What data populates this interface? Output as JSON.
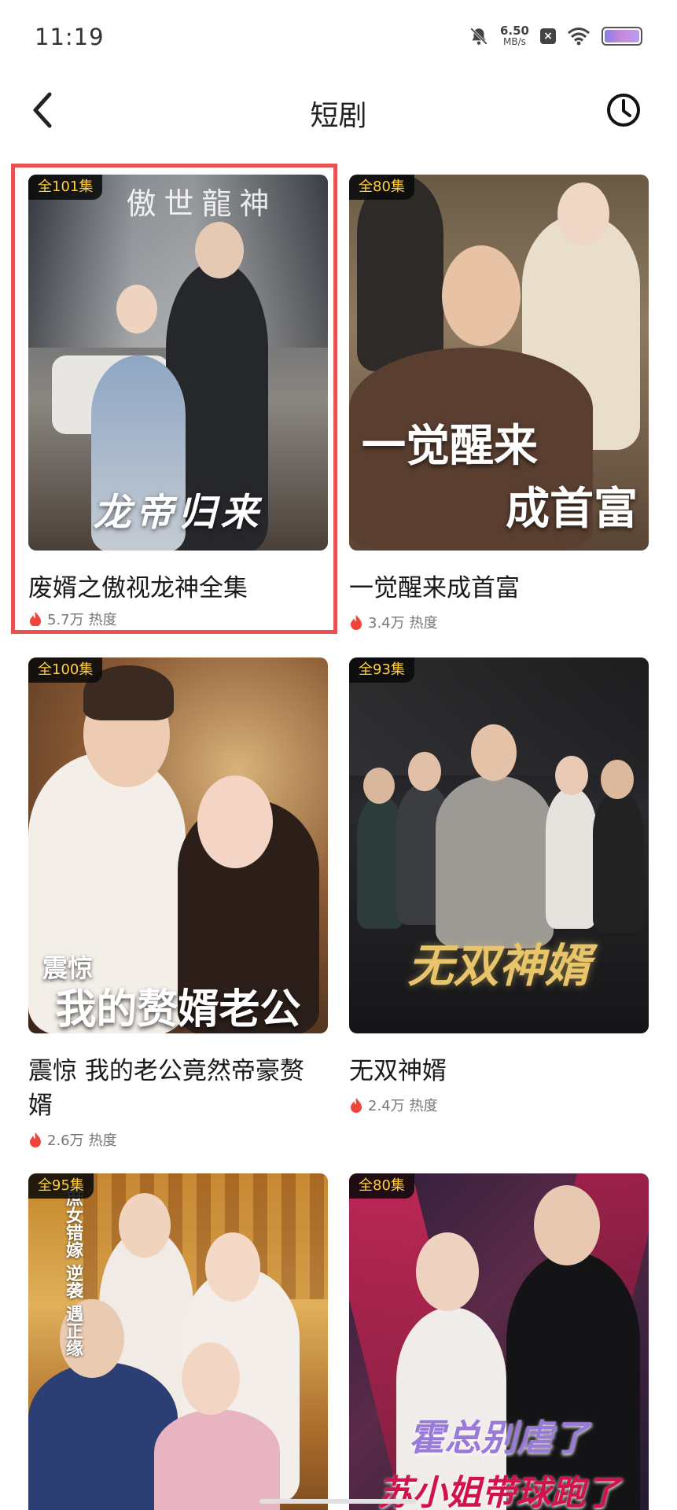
{
  "status_bar": {
    "time": "11:19",
    "net_speed": "6.50",
    "net_unit": "MB/s",
    "icons": [
      "bell-off-icon",
      "x-badge-icon",
      "wifi-icon",
      "battery-icon"
    ]
  },
  "header": {
    "title": "短剧",
    "back_icon": "chevron-left-icon",
    "history_icon": "clock-icon"
  },
  "cards": [
    {
      "badge": "全101集",
      "poster_top_text": "傲世龍神",
      "poster_title": "龙帝归来",
      "title": "废婿之傲视龙神全集",
      "heat": "5.7万",
      "heat_label": "热度",
      "highlighted": true
    },
    {
      "badge": "全80集",
      "poster_title_line1": "一觉醒来",
      "poster_title_line2": "成首富",
      "title": "一觉醒来成首富",
      "heat": "3.4万",
      "heat_label": "热度"
    },
    {
      "badge": "全100集",
      "poster_sub": "震惊",
      "poster_title": "我的赘婿老公",
      "title": "震惊 我的老公竟然帝豪赘婿",
      "heat": "2.6万",
      "heat_label": "热度"
    },
    {
      "badge": "全93集",
      "poster_title": "无双神婿",
      "title": "无双神婿",
      "heat": "2.4万",
      "heat_label": "热度"
    },
    {
      "badge": "全95集",
      "poster_side_text": "庶女错嫁 逆袭 遇正缘",
      "title": "",
      "heat": "",
      "heat_label": ""
    },
    {
      "badge": "全80集",
      "poster_title_line1": "霍总别虐了",
      "poster_title_line2": "苏小姐带球跑了",
      "title": "",
      "heat": "",
      "heat_label": ""
    }
  ],
  "colors": {
    "accent_red": "#e8514f",
    "badge_text": "#ffcf3f",
    "heat_flame": "#f0443a"
  }
}
